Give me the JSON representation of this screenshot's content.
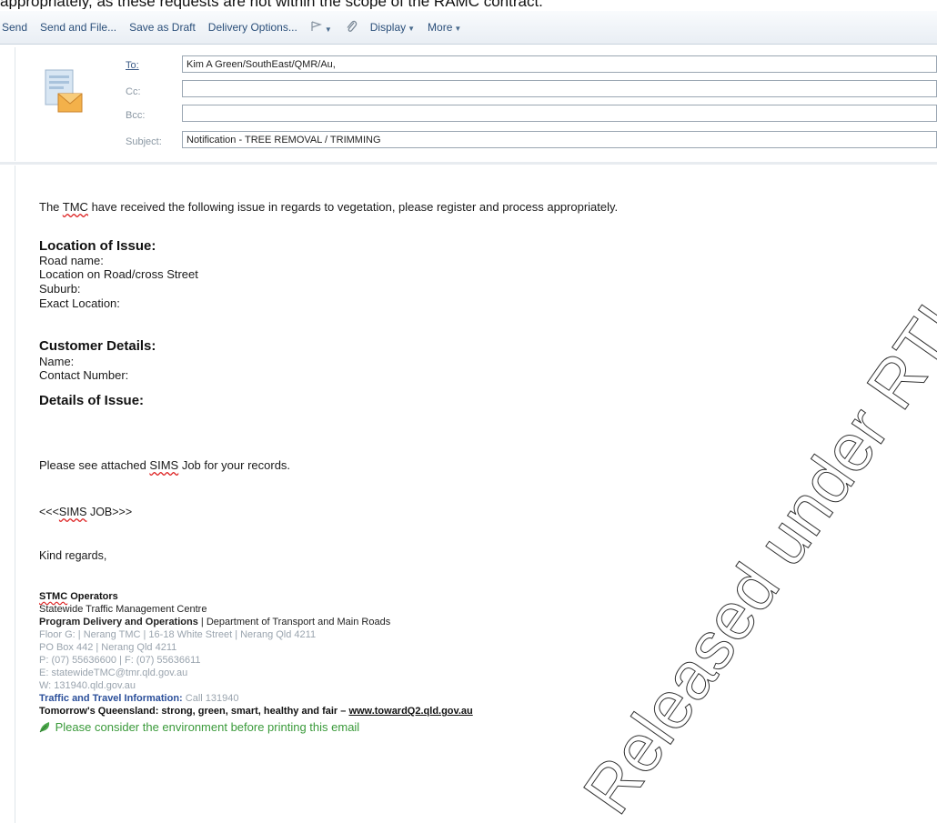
{
  "caption": "appropriately, as these requests are not within the scope of the RAMC contract.",
  "toolbar": {
    "send": "Send",
    "send_and_file": "Send and File...",
    "save_as_draft": "Save as Draft",
    "delivery_options": "Delivery Options...",
    "flag_icon": "flag-icon",
    "attach_icon": "paperclip-icon",
    "display": "Display",
    "more": "More"
  },
  "fields": {
    "to_label": "To:",
    "to_value": "Kim A Green/SouthEast/QMR/Au,",
    "cc_label": "Cc:",
    "cc_value": "",
    "bcc_label": "Bcc:",
    "bcc_value": "",
    "subject_label": "Subject:",
    "subject_value": "Notification - TREE REMOVAL / TRIMMING"
  },
  "body": {
    "intro_pre": "The ",
    "intro_tmc": "TMC",
    "intro_post": " have received the following issue in regards to vegetation, please register and process appropriately.",
    "location_heading": "Location of Issue:",
    "road_name": "Road name:",
    "location_on_road": "Location on Road/cross Street",
    "suburb": "Suburb:",
    "exact_location": "Exact Location:",
    "customer_heading": "Customer Details:",
    "name": "Name:",
    "contact_number": "Contact Number:",
    "details_heading": "Details of Issue:",
    "see_attached_pre": "Please see attached ",
    "see_attached_sims": "SIMS",
    "see_attached_post": " Job for your records.",
    "sims_job_pre": "<<<",
    "sims_job_sims": "SIMS",
    "sims_job_post": " JOB>>>",
    "kind_regards": "Kind regards,"
  },
  "signature": {
    "stmc": "STMC",
    "operators": " Operators",
    "centre": "Statewide Traffic Management Centre",
    "program_bold": "Program Delivery and Operations",
    "program_rest": " | Department of Transport and Main Roads",
    "floor": "Floor G: | Nerang TMC | 16-18 White Street | Nerang Qld 4211",
    "pobox": "PO Box 442 | Nerang Qld 4211",
    "phone": "P: (07) 55636600 | F: (07) 55636611",
    "email": "E: statewideTMC@tmr.qld.gov.au",
    "web": "W: 131940.qld.gov.au",
    "traffic_label": "Traffic and Travel Information:",
    "traffic_value": " Call 131940",
    "tomorrow": "Tomorrow's Queensland: strong, green, smart, healthy and fair – ",
    "tomorrow_link": "www.towardQ2.qld.gov.au",
    "environment": "Please consider the environment before printing this email"
  },
  "watermark": "Released under RTI - DTMR"
}
